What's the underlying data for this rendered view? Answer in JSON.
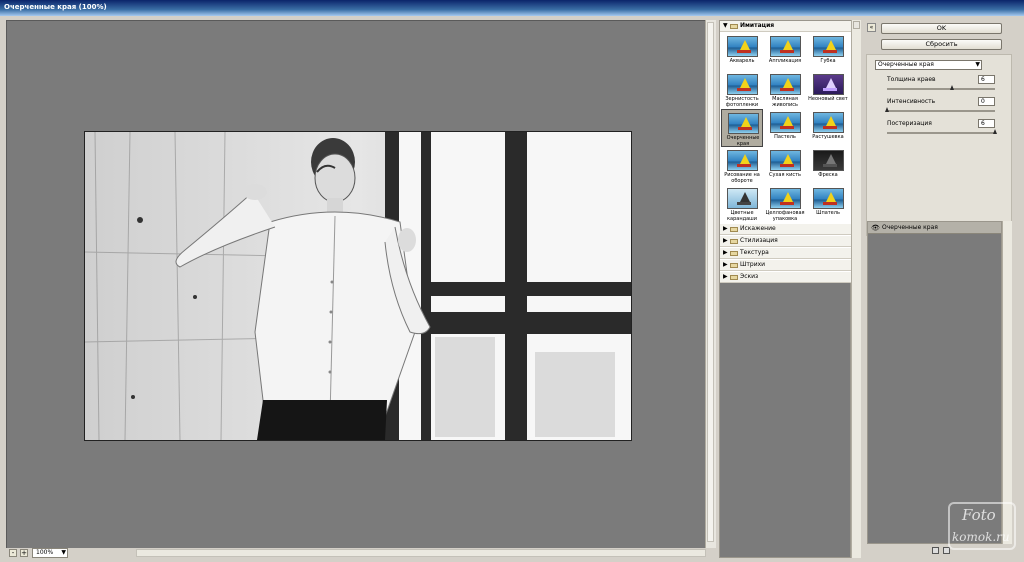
{
  "window": {
    "title": "Очерченные края (100%)"
  },
  "zoom": {
    "minus_label": "-",
    "plus_label": "+",
    "value": "100%"
  },
  "buttons": {
    "ok": "OK",
    "reset": "Сбросить"
  },
  "gallery": {
    "open_category": "Имитация",
    "filters": [
      {
        "label": "Акварель"
      },
      {
        "label": "Аппликация"
      },
      {
        "label": "Губка"
      },
      {
        "label": "Зернистость фотопленки"
      },
      {
        "label": "Масляная живопись"
      },
      {
        "label": "Неоновый свет"
      },
      {
        "label": "Очерченные края"
      },
      {
        "label": "Пастель"
      },
      {
        "label": "Растушевка"
      },
      {
        "label": "Рисование на обороте"
      },
      {
        "label": "Сухая кисть"
      },
      {
        "label": "Фреска"
      },
      {
        "label": "Цветные карандаши"
      },
      {
        "label": "Целлофановая упаковка"
      },
      {
        "label": "Шпатель"
      }
    ],
    "selected_index": 6,
    "categories": [
      "Искажение",
      "Стилизация",
      "Текстура",
      "Штрихи",
      "Эскиз"
    ]
  },
  "settings": {
    "filter_name": "Очерченные края",
    "params": [
      {
        "label": "Толщина краев",
        "value": "6",
        "fraction": 0.6
      },
      {
        "label": "Интенсивность",
        "value": "0",
        "fraction": 0.0
      },
      {
        "label": "Постеризация",
        "value": "6",
        "fraction": 1.0
      }
    ]
  },
  "layers": [
    {
      "label": "Очерченные края"
    }
  ],
  "watermark": {
    "line1": "Foto",
    "line2": "komok.ru"
  },
  "colors": {
    "canvas_bg": "#7b7b7b",
    "panel_bg": "#d4d0c8",
    "title_bar": "#0a246a"
  }
}
